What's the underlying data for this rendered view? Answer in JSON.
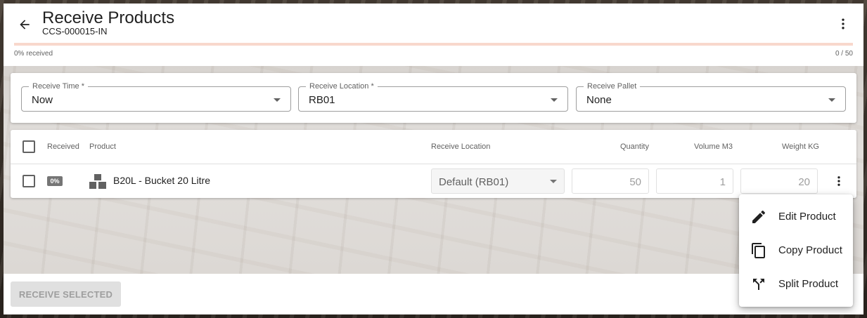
{
  "header": {
    "title": "Receive Products",
    "subtitle": "CCS-000015-IN",
    "progress_label": "0% received",
    "progress_count": "0 / 50",
    "progress_fraction": 0.0
  },
  "filters": {
    "receive_time": {
      "label": "Receive Time *",
      "value": "Now"
    },
    "receive_location": {
      "label": "Receive Location *",
      "value": "RB01"
    },
    "receive_pallet": {
      "label": "Receive Pallet",
      "value": "None"
    }
  },
  "table": {
    "headers": {
      "received": "Received",
      "product": "Product",
      "receive_location": "Receive Location",
      "quantity": "Quantity",
      "volume": "Volume M3",
      "weight": "Weight KG"
    },
    "rows": [
      {
        "badge": "0%",
        "product": "B20L - Bucket 20 Litre",
        "location": "Default (RB01)",
        "quantity": "50",
        "volume": "1",
        "weight": "20"
      }
    ]
  },
  "footer": {
    "receive_selected": "RECEIVE SELECTED"
  },
  "context_menu": {
    "items": [
      {
        "label": "Edit Product",
        "icon": "pencil-icon"
      },
      {
        "label": "Copy Product",
        "icon": "copy-icon"
      },
      {
        "label": "Split Product",
        "icon": "split-icon"
      }
    ]
  },
  "colors": {
    "accent": "#e65a2b",
    "progress_track": "#f8d8cc"
  }
}
